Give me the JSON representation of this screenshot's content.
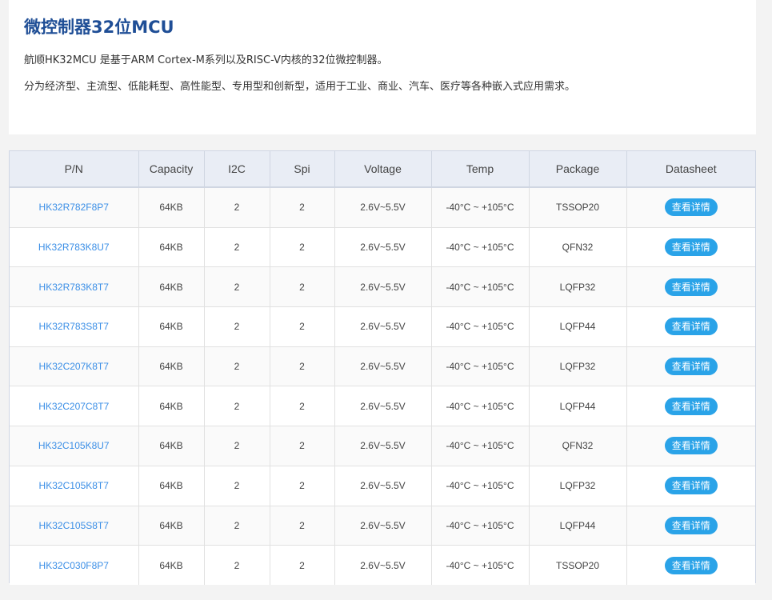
{
  "intro": {
    "title": "微控制器32位MCU",
    "desc1": "航顺HK32MCU 是基于ARM Cortex-M系列以及RISC-V内核的32位微控制器。",
    "desc2": "分为经济型、主流型、低能耗型、高性能型、专用型和创新型，适用于工业、商业、汽车、医疗等各种嵌入式应用需求。"
  },
  "table": {
    "headers": [
      "P/N",
      "Capacity",
      "I2C",
      "Spi",
      "Voltage",
      "Temp",
      "Package",
      "Datasheet"
    ],
    "button_label": "查看详情",
    "rows": [
      {
        "pn": "HK32R782F8P7",
        "capacity": "64KB",
        "i2c": "2",
        "spi": "2",
        "voltage": "2.6V~5.5V",
        "temp": "-40°C ~ +105°C",
        "package": "TSSOP20"
      },
      {
        "pn": "HK32R783K8U7",
        "capacity": "64KB",
        "i2c": "2",
        "spi": "2",
        "voltage": "2.6V~5.5V",
        "temp": "-40°C ~ +105°C",
        "package": "QFN32"
      },
      {
        "pn": "HK32R783K8T7",
        "capacity": "64KB",
        "i2c": "2",
        "spi": "2",
        "voltage": "2.6V~5.5V",
        "temp": "-40°C ~ +105°C",
        "package": "LQFP32"
      },
      {
        "pn": "HK32R783S8T7",
        "capacity": "64KB",
        "i2c": "2",
        "spi": "2",
        "voltage": "2.6V~5.5V",
        "temp": "-40°C ~ +105°C",
        "package": "LQFP44"
      },
      {
        "pn": "HK32C207K8T7",
        "capacity": "64KB",
        "i2c": "2",
        "spi": "2",
        "voltage": "2.6V~5.5V",
        "temp": "-40°C ~ +105°C",
        "package": "LQFP32"
      },
      {
        "pn": "HK32C207C8T7",
        "capacity": "64KB",
        "i2c": "2",
        "spi": "2",
        "voltage": "2.6V~5.5V",
        "temp": "-40°C ~ +105°C",
        "package": "LQFP44"
      },
      {
        "pn": "HK32C105K8U7",
        "capacity": "64KB",
        "i2c": "2",
        "spi": "2",
        "voltage": "2.6V~5.5V",
        "temp": "-40°C ~ +105°C",
        "package": "QFN32"
      },
      {
        "pn": "HK32C105K8T7",
        "capacity": "64KB",
        "i2c": "2",
        "spi": "2",
        "voltage": "2.6V~5.5V",
        "temp": "-40°C ~ +105°C",
        "package": "LQFP32"
      },
      {
        "pn": "HK32C105S8T7",
        "capacity": "64KB",
        "i2c": "2",
        "spi": "2",
        "voltage": "2.6V~5.5V",
        "temp": "-40°C ~ +105°C",
        "package": "LQFP44"
      },
      {
        "pn": "HK32C030F8P7",
        "capacity": "64KB",
        "i2c": "2",
        "spi": "2",
        "voltage": "2.6V~5.5V",
        "temp": "-40°C ~ +105°C",
        "package": "TSSOP20"
      }
    ]
  },
  "colors": {
    "title": "#1f4e96",
    "link": "#3a8ee6",
    "button": "#2aa3e8",
    "header_bg": "#e9edf5"
  }
}
